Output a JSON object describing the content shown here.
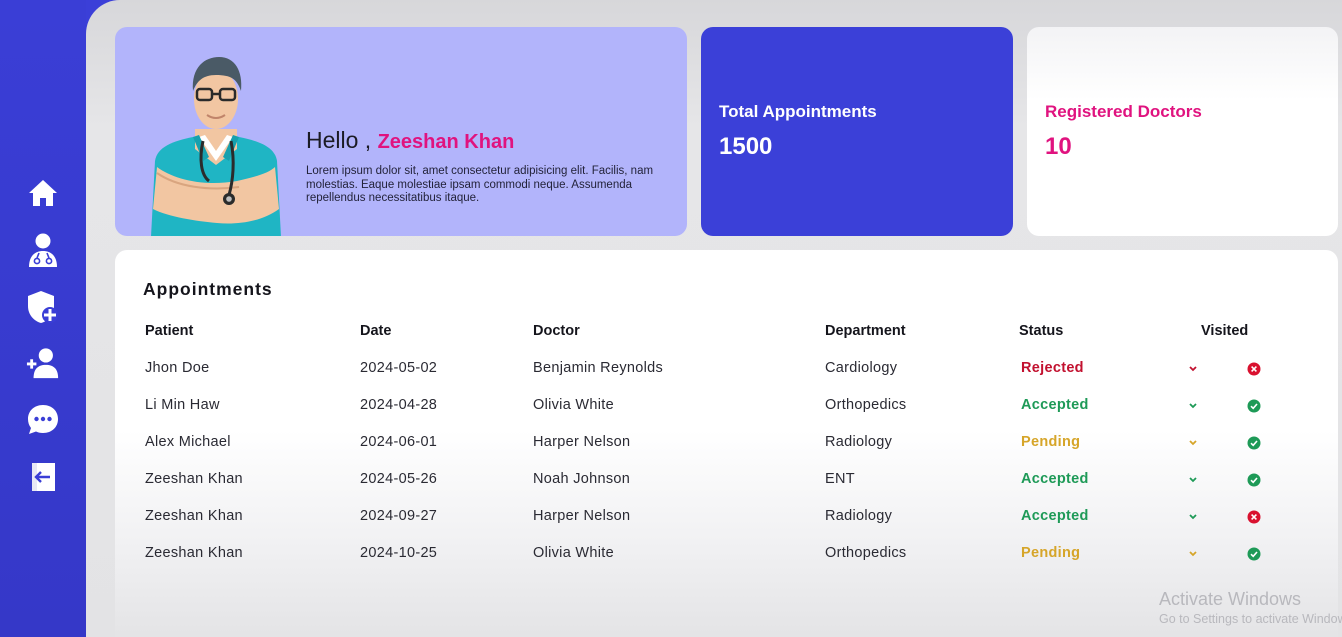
{
  "colors": {
    "sidebar": "#3a3ed6",
    "accent_pink": "#e0137f",
    "card_blue": "#3b40d8",
    "hero_lavender": "#b2b4fb",
    "rejected": "#c2112f",
    "accepted": "#1e9a57",
    "pending": "#d6a529"
  },
  "sidebar": {
    "items": [
      {
        "icon": "home-icon"
      },
      {
        "icon": "doctor-icon"
      },
      {
        "icon": "shield-plus-icon"
      },
      {
        "icon": "add-user-icon"
      },
      {
        "icon": "chat-icon"
      },
      {
        "icon": "logout-icon"
      }
    ]
  },
  "hero": {
    "greeting": "Hello , ",
    "name": "Zeeshan Khan",
    "description": "Lorem ipsum dolor sit, amet consectetur adipisicing elit. Facilis, nam molestias. Eaque molestiae ipsam commodi neque. Assumenda repellendus necessitatibus itaque."
  },
  "stats": {
    "appointments": {
      "label": "Total Appointments",
      "value": "1500"
    },
    "doctors": {
      "label": "Registered Doctors",
      "value": "10"
    }
  },
  "appointments": {
    "title": "Appointments",
    "headers": {
      "patient": "Patient",
      "date": "Date",
      "doctor": "Doctor",
      "department": "Department",
      "status": "Status",
      "visited": "Visited"
    },
    "rows": [
      {
        "patient": "Jhon Doe",
        "date": "2024-05-02",
        "doctor": "Benjamin Reynolds",
        "department": "Cardiology",
        "status": "Rejected",
        "visited": false
      },
      {
        "patient": "Li Min Haw",
        "date": "2024-04-28",
        "doctor": "Olivia White",
        "department": "Orthopedics",
        "status": "Accepted",
        "visited": true
      },
      {
        "patient": "Alex Michael",
        "date": "2024-06-01",
        "doctor": "Harper Nelson",
        "department": "Radiology",
        "status": "Pending",
        "visited": true
      },
      {
        "patient": "Zeeshan Khan",
        "date": "2024-05-26",
        "doctor": "Noah Johnson",
        "department": "ENT",
        "status": "Accepted",
        "visited": true
      },
      {
        "patient": "Zeeshan Khan",
        "date": "2024-09-27",
        "doctor": "Harper Nelson",
        "department": "Radiology",
        "status": "Accepted",
        "visited": false
      },
      {
        "patient": "Zeeshan Khan",
        "date": "2024-10-25",
        "doctor": "Olivia White",
        "department": "Orthopedics",
        "status": "Pending",
        "visited": true
      }
    ]
  },
  "watermark": {
    "line1": "Activate Windows",
    "line2": "Go to Settings to activate Windows."
  }
}
